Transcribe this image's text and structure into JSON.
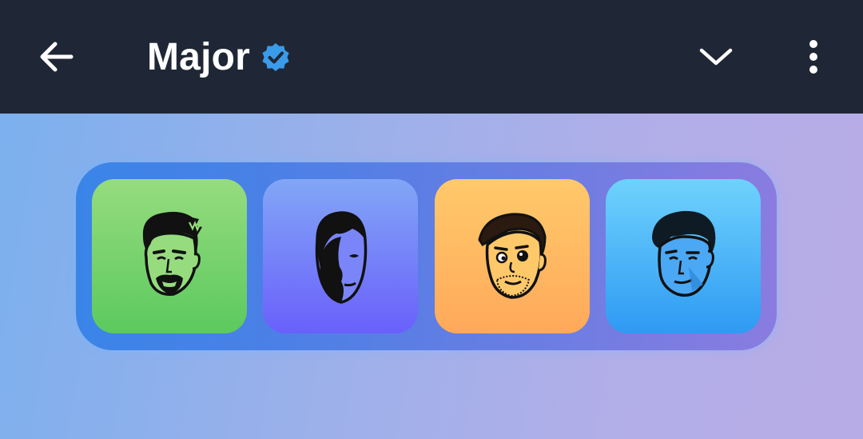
{
  "header": {
    "title": "Major",
    "verified_icon": "verified-badge-icon",
    "back_icon": "arrow-left-icon",
    "dropdown_icon": "chevron-down-icon",
    "menu_icon": "more-vertical-icon",
    "colors": {
      "bar": "#1f2736",
      "badge": "#3a9bea",
      "text": "#ffffff"
    }
  },
  "avatars": [
    {
      "name": "avatar-1",
      "bg_top": "#96dc7e",
      "bg_bottom": "#5cc95e"
    },
    {
      "name": "avatar-2",
      "bg_top": "#82a6f6",
      "bg_bottom": "#6a60fb"
    },
    {
      "name": "avatar-3",
      "bg_top": "#ffc96a",
      "bg_bottom": "#ffa95a"
    },
    {
      "name": "avatar-4",
      "bg_top": "#6fd2fc",
      "bg_bottom": "#2e9af3"
    }
  ]
}
